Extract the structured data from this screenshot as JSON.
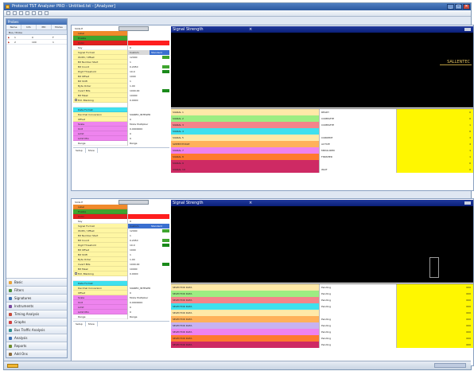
{
  "window": {
    "title": "Protocol TST Analyzer PRO - Untitled.tst - [Analyzer]",
    "controls": [
      "_",
      "□",
      "✕"
    ]
  },
  "toolbar": {
    "icons": [
      "new-icon",
      "open-icon",
      "save-icon",
      "stop-icon",
      "run-icon",
      "settings-icon",
      "help-icon"
    ]
  },
  "left_pane": {
    "title": "Probes",
    "tabs": [
      "Name",
      "Info",
      "PID",
      "Modes"
    ],
    "grid_header": "Bus / Probe",
    "rows": [
      {
        "mark": "▶",
        "a": "1",
        "b": "0",
        "c": "F"
      },
      {
        "mark": "▶",
        "a": "2",
        "b": "100",
        "c": "1"
      }
    ],
    "nav": [
      {
        "label": "Basic",
        "color": "#e8a33a"
      },
      {
        "label": "Filters",
        "color": "#4a8e3c"
      },
      {
        "label": "Signatures",
        "color": "#3a6fb0"
      },
      {
        "label": "Instruments",
        "color": "#7a4aa0"
      },
      {
        "label": "Timing Analysis",
        "color": "#c34a3a"
      },
      {
        "label": "Graphs",
        "color": "#d04040"
      },
      {
        "label": "Bus Traffic Analysis",
        "color": "#2f8f8f"
      },
      {
        "label": "Analysis",
        "color": "#3a6fb0"
      },
      {
        "label": "Reports",
        "color": "#6d8c2a"
      },
      {
        "label": "Add Ons",
        "color": "#8a6a3a"
      }
    ]
  },
  "panels": [
    {
      "id": "panel-1",
      "prop_header": {
        "label": "Slots",
        "marker": "E"
      },
      "scope_title": "Signal Strength",
      "scope_center_mark": "×",
      "props": [
        {
          "label": "Label",
          "value": "",
          "bg": "#f08a2b"
        },
        {
          "label": "Enable",
          "value": "",
          "bg": "#3fa52f"
        },
        {
          "label": "Color",
          "value": "",
          "bg": "#e02020",
          "vbg": "#ff1e1e"
        },
        {
          "label": "Key",
          "value": "0",
          "bg": "#ffffff"
        },
        {
          "label": "Signal Format",
          "value": "Custom",
          "bg": "#fff6a3",
          "vbg": "#d9d9d9",
          "extra": "Standard",
          "extra_bg": "#3a6fd0"
        },
        {
          "label": "Width / Offset",
          "value": "12000",
          "bg": "#fff6a3",
          "tail": "#3fa52f"
        },
        {
          "label": "Bit Number Start",
          "value": "1",
          "bg": "#fff6a3"
        },
        {
          "label": "Bit Count",
          "value": "0.2450",
          "bg": "#fff6a3",
          "tail": "#3fa52f"
        },
        {
          "label": "Digit Threshold",
          "value": "10.0",
          "bg": "#fff6a3",
          "tail": "#1a8a1a"
        },
        {
          "label": "Bit Offset",
          "value": "1000",
          "bg": "#fff6a3"
        },
        {
          "label": "Bit Shift",
          "value": "1",
          "bg": "#fff6a3"
        },
        {
          "label": "Byte Order",
          "value": "1.00",
          "bg": "#fff6a3"
        },
        {
          "label": "Invert Bits",
          "value": "1000.00",
          "bg": "#fff6a3",
          "tail": "#1a8a1a"
        },
        {
          "label": "Bit Mask",
          "value": "10000",
          "bg": "#fff6a3"
        },
        {
          "label": "Ext. Blanking",
          "value": "0.0000",
          "bg": "#fff6a3",
          "chk": true
        },
        {
          "label": "",
          "value": "",
          "bg": "#ffffff"
        },
        {
          "label": "Data Format",
          "value": "",
          "bg": "#3fe0ee"
        },
        {
          "label": "Decimal Conversion",
          "value": "SIGNED_INTEGER",
          "bg": "#fff6a3"
        },
        {
          "label": "Offset",
          "value": "0",
          "bg": "#fff6a3"
        },
        {
          "label": "Scale",
          "value": "Mode Multiplier",
          "bg": "#ee84ee"
        },
        {
          "label": "Unit",
          "value": "0.0000000",
          "bg": "#ee84ee"
        },
        {
          "label": "Limit",
          "value": "0",
          "bg": "#ee84ee"
        },
        {
          "label": "Limit Min",
          "value": "0",
          "bg": "#ee84ee"
        },
        {
          "label": "Range",
          "value": "Range",
          "bg": "#ffffff"
        }
      ],
      "prop_tabs": [
        "Setup",
        "Show"
      ],
      "signal_label": "SALLENTEC",
      "signals": [
        {
          "name": "SIGNAL 1",
          "state": "READY",
          "value": "0",
          "bg": "#ffe9a8"
        },
        {
          "name": "SIGNAL 2",
          "state": "COMPLETE",
          "value": "0",
          "bg": "#9ded82"
        },
        {
          "name": "SIGNAL 3",
          "state": "COMPLETE",
          "value": "1",
          "bg": "#f4848a"
        },
        {
          "name": "SIGNAL 4",
          "state": "",
          "value": "0",
          "bg": "#3fe0ee"
        },
        {
          "name": "SIGNAL 5",
          "state": "CURRENT",
          "value": "3",
          "bg": "#ffe9a8"
        },
        {
          "name": "SWEEP PHASE",
          "state": "ACTIVE",
          "value": "4",
          "bg": "#ffb15a"
        },
        {
          "name": "SIGNAL 7",
          "state": "MEASURED",
          "value": "1",
          "bg": "#ef82ef"
        },
        {
          "name": "SIGNAL 8",
          "state": "FINISHED",
          "value": "1",
          "bg": "#ff7a2f"
        },
        {
          "name": "SIGNAL 9",
          "state": "",
          "value": "0",
          "bg": "#ce2a64"
        },
        {
          "name": "SIGNAL 10",
          "state": "WAIT",
          "value": "0",
          "bg": "#ce2a64"
        }
      ]
    },
    {
      "id": "panel-2",
      "prop_header": {
        "label": "Slots",
        "marker": "E"
      },
      "scope_title": "Signal Strength",
      "scope_center_mark": "×",
      "props": [
        {
          "label": "Label",
          "value": "",
          "bg": "#f08a2b"
        },
        {
          "label": "Enable",
          "value": "",
          "bg": "#3fa52f"
        },
        {
          "label": "Color",
          "value": "",
          "bg": "#e02020",
          "vbg": "#ff1e1e"
        },
        {
          "label": "Key",
          "value": "0",
          "bg": "#ffffff"
        },
        {
          "label": "Signal Format",
          "value": "Custom",
          "bg": "#fff6a3",
          "vbg": "#3a6fd0",
          "extra": "Standard",
          "extra_bg": "#3a6fd0"
        },
        {
          "label": "Width / Offset",
          "value": "12000",
          "bg": "#fff6a3",
          "tail": "#3fa52f"
        },
        {
          "label": "Bit Number Start",
          "value": "1",
          "bg": "#fff6a3"
        },
        {
          "label": "Bit Count",
          "value": "0.2450",
          "bg": "#fff6a3",
          "tail": "#3fa52f"
        },
        {
          "label": "Digit Threshold",
          "value": "10.0",
          "bg": "#fff6a3",
          "tail": "#1a8a1a"
        },
        {
          "label": "Bit Offset",
          "value": "1000",
          "bg": "#fff6a3"
        },
        {
          "label": "Bit Shift",
          "value": "1",
          "bg": "#fff6a3"
        },
        {
          "label": "Byte Order",
          "value": "1.00",
          "bg": "#fff6a3"
        },
        {
          "label": "Invert Bits",
          "value": "1000.00",
          "bg": "#fff6a3",
          "tail": "#1a8a1a"
        },
        {
          "label": "Bit Mask",
          "value": "10000",
          "bg": "#fff6a3"
        },
        {
          "label": "Ext. Blanking",
          "value": "0.0000",
          "bg": "#fff6a3",
          "chk": true
        },
        {
          "label": "",
          "value": "",
          "bg": "#ffffff"
        },
        {
          "label": "Data Format",
          "value": "",
          "bg": "#3fe0ee"
        },
        {
          "label": "Decimal Conversion",
          "value": "SIGNED_INTEGER",
          "bg": "#fff6a3"
        },
        {
          "label": "Offset",
          "value": "0",
          "bg": "#fff6a3"
        },
        {
          "label": "Scale",
          "value": "Mode Multiplier",
          "bg": "#ee84ee"
        },
        {
          "label": "Unit",
          "value": "0.0000000",
          "bg": "#ee84ee"
        },
        {
          "label": "Limit",
          "value": "0",
          "bg": "#ee84ee"
        },
        {
          "label": "Limit Min",
          "value": "0",
          "bg": "#ee84ee"
        },
        {
          "label": "Range",
          "value": "Range",
          "bg": "#ffffff"
        }
      ],
      "prop_tabs": [
        "Setup",
        "Show"
      ],
      "signal_label": "",
      "signals": [
        {
          "name": "SELECTOR DATA",
          "state": "Pending",
          "value": "000",
          "bg": "#ffe9a8"
        },
        {
          "name": "SELECTOR DATA",
          "state": "Pending",
          "value": "000",
          "bg": "#9ded82"
        },
        {
          "name": "SELECTOR DATA",
          "state": "Pending",
          "value": "000",
          "bg": "#f4848a"
        },
        {
          "name": "SELECTOR DATA",
          "state": "Pending",
          "value": "000",
          "bg": "#3fe0ee"
        },
        {
          "name": "SELECTOR DATA",
          "state": "",
          "value": "000",
          "bg": "#ffe9a8"
        },
        {
          "name": "SELECTOR DATA",
          "state": "Pending",
          "value": "000",
          "bg": "#ffb15a"
        },
        {
          "name": "SELECTOR DATA",
          "state": "Pending",
          "value": "000",
          "bg": "#c7b2f2"
        },
        {
          "name": "SELECTOR DATA",
          "state": "Pending",
          "value": "000",
          "bg": "#ef82ef"
        },
        {
          "name": "SELECTOR DATA",
          "state": "Pending",
          "value": "000",
          "bg": "#ff7a2f"
        },
        {
          "name": "SELECTOR DATA",
          "state": "Pending",
          "value": "000",
          "bg": "#ce2a64"
        }
      ]
    }
  ]
}
